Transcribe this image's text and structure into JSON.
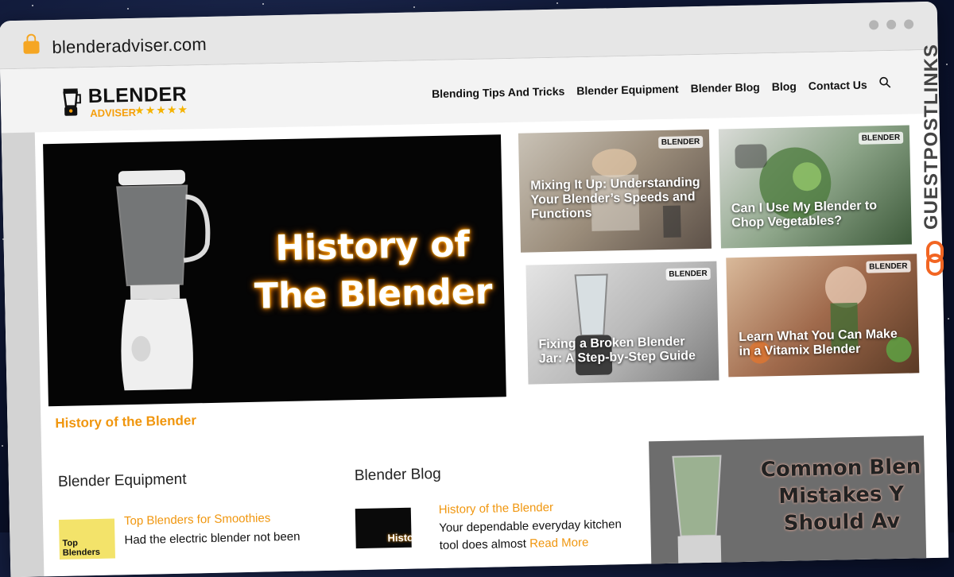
{
  "browser": {
    "url": "blenderadviser.com"
  },
  "site": {
    "logo_text": "BLENDER",
    "logo_sub": "ADVISER",
    "logo_stars": "★★★★★",
    "nav": [
      {
        "label": "Blending Tips And Tricks"
      },
      {
        "label": "Blender Equipment"
      },
      {
        "label": "Blender Blog"
      },
      {
        "label": "Blog"
      },
      {
        "label": "Contact Us"
      }
    ]
  },
  "hero": {
    "image_text_line1": "History of",
    "image_text_line2": "The Blender",
    "caption": "History of the Blender"
  },
  "cards": [
    {
      "title": "Mixing It Up: Understanding Your Blender’s Speeds and Functions",
      "badge": "BLENDER"
    },
    {
      "title": "Can I Use My Blender to Chop Vegetables?",
      "badge": "BLENDER"
    },
    {
      "title": "Fixing a Broken Blender Jar: A Step-by-Step Guide",
      "badge": "BLENDER"
    },
    {
      "title": "Learn What You Can Make in a Vitamix Blender",
      "badge": "BLENDER"
    }
  ],
  "equipment_section": {
    "heading": "Blender Equipment",
    "post_title": "Top Blenders for Smoothies",
    "post_excerpt": "Had the electric blender not been",
    "thumb_text": "Top Blenders"
  },
  "blog_section": {
    "heading": "Blender Blog",
    "post_title": "History of the Blender",
    "post_excerpt_line1": "Your dependable everyday kitchen",
    "post_excerpt_line2": "tool does almost",
    "read_more": "Read More",
    "thumb_text": "Histor"
  },
  "promo": {
    "line1": "Common Blen",
    "line2": "Mistakes Y",
    "line3": "Should Av"
  },
  "watermark": {
    "text": "GUESTPOSTLINKS"
  },
  "colors": {
    "accent": "#f0960e",
    "lock": "#f5a623",
    "logo_orange": "#f59e0b"
  }
}
